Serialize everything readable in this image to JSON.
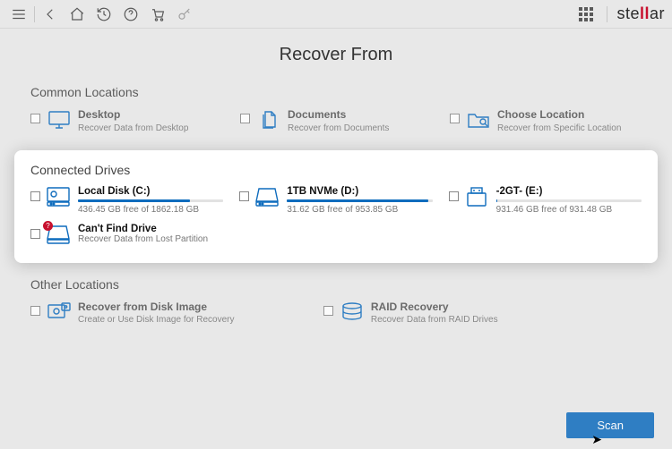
{
  "brand": {
    "prefix": "ste",
    "mid": "ll",
    "suffix": "ar"
  },
  "page_title": "Recover From",
  "common": {
    "heading": "Common Locations",
    "items": [
      {
        "title": "Desktop",
        "sub": "Recover Data from Desktop"
      },
      {
        "title": "Documents",
        "sub": "Recover from Documents"
      },
      {
        "title": "Choose Location",
        "sub": "Recover from Specific Location"
      }
    ]
  },
  "drives": {
    "heading": "Connected Drives",
    "items": [
      {
        "title": "Local Disk (C:)",
        "free": "436.45 GB free of 1862.18 GB",
        "fill_pct": 77
      },
      {
        "title": "1TB NVMe (D:)",
        "free": "31.62 GB free of 953.85 GB",
        "fill_pct": 97
      },
      {
        "title": "-2GT- (E:)",
        "free": "931.46 GB free of 931.48 GB",
        "fill_pct": 1
      }
    ],
    "lost": {
      "title": "Can't Find Drive",
      "sub": "Recover Data from Lost Partition",
      "badge": "?"
    }
  },
  "other": {
    "heading": "Other Locations",
    "items": [
      {
        "title": "Recover from Disk Image",
        "sub": "Create or Use Disk Image for Recovery"
      },
      {
        "title": "RAID Recovery",
        "sub": "Recover Data from RAID Drives"
      }
    ]
  },
  "scan_label": "Scan"
}
